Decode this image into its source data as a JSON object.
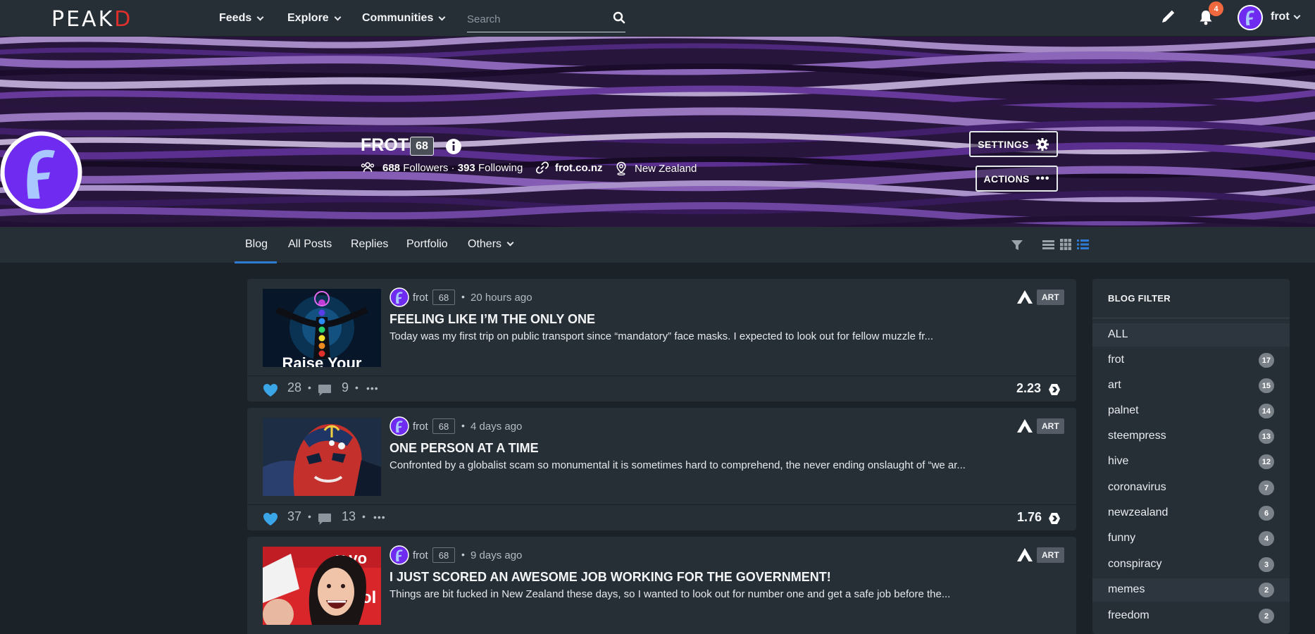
{
  "header": {
    "logo_main": "PEAK",
    "logo_d": "D",
    "nav": [
      {
        "label": "Feeds"
      },
      {
        "label": "Explore"
      },
      {
        "label": "Communities"
      }
    ],
    "search_placeholder": "Search",
    "notification_count": "4",
    "username": "frot",
    "icons": [
      "search-icon",
      "pencil-icon",
      "bell-icon",
      "chevron-down-icon"
    ]
  },
  "profile": {
    "name": "FROT",
    "reputation": "68",
    "followers_count": "688",
    "followers_label": "Followers",
    "following_count": "393",
    "following_label": "Following",
    "website": "frot.co.nz",
    "location": "New Zealand",
    "settings_label": "SETTINGS",
    "actions_label": "ACTIONS",
    "colors": {
      "avatar_purple": "#6f2cf0",
      "avatar_ring": "#ffffff",
      "cover_purple": "#8a5cc4"
    }
  },
  "tabs": [
    {
      "label": "Blog",
      "active": true
    },
    {
      "label": "All Posts"
    },
    {
      "label": "Replies"
    },
    {
      "label": "Portfolio"
    },
    {
      "label": "Others"
    }
  ],
  "posts": [
    {
      "author": "frot",
      "rep": "68",
      "time": "20 hours ago",
      "community": "ART",
      "title": "FEELING LIKE I’M THE ONLY ONE",
      "excerpt": "Today was my first trip on public transport since “mandatory” face masks. I expected to look out for fellow muzzle fr...",
      "thumb_caption": "Raise Your",
      "likes": "28",
      "comments": "9",
      "payout": "2.23"
    },
    {
      "author": "frot",
      "rep": "68",
      "time": "4 days ago",
      "community": "ART",
      "title": "ONE PERSON AT A TIME",
      "excerpt": "Confronted by a globalist scam so monumental it is sometimes hard to comprehend, the never ending onslaught of “we ar...",
      "likes": "37",
      "comments": "13",
      "payout": "1.76"
    },
    {
      "author": "frot",
      "rep": "68",
      "time": "9 days ago",
      "community": "ART",
      "title": "I JUST SCORED AN AWESOME JOB WORKING FOR THE GOVERNMENT!",
      "excerpt": "Things are bit fucked in New Zealand these days, so I wanted to look out for number one and get a safe job before the...",
      "thumb_caption": "y vo",
      "thumb_caption2": "ol"
    }
  ],
  "sidebar": {
    "title": "BLOG FILTER",
    "items": [
      {
        "label": "ALL",
        "count": ""
      },
      {
        "label": "frot",
        "count": "17"
      },
      {
        "label": "art",
        "count": "15"
      },
      {
        "label": "palnet",
        "count": "14"
      },
      {
        "label": "steempress",
        "count": "13"
      },
      {
        "label": "hive",
        "count": "12"
      },
      {
        "label": "coronavirus",
        "count": "7"
      },
      {
        "label": "newzealand",
        "count": "6"
      },
      {
        "label": "funny",
        "count": "4"
      },
      {
        "label": "conspiracy",
        "count": "3"
      },
      {
        "label": "memes",
        "count": "2"
      },
      {
        "label": "freedom",
        "count": "2"
      }
    ]
  },
  "colors": {
    "page_bg": "#1b2228",
    "panel_bg": "#262e36",
    "accent_blue": "#2f7bd4",
    "like_blue": "#3aa6e8",
    "badge_orange": "#f0683e",
    "logo_red": "#e0302c"
  }
}
